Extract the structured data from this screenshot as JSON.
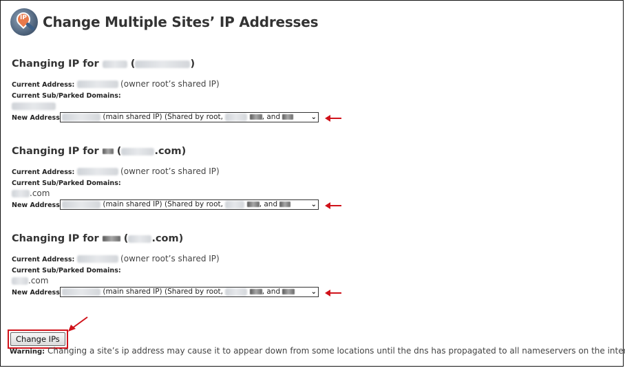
{
  "page": {
    "title": "Change Multiple Sites’ IP Addresses",
    "icon_text": "IP"
  },
  "sections": [
    {
      "heading_prefix": "Changing IP for",
      "heading_domain_suffix": "",
      "current_address_label": "Current Address:",
      "current_address_note": "(owner root’s shared IP)",
      "sub_parked_label": "Current Sub/Parked Domains:",
      "sub_parked_suffix": "",
      "new_address_label": "New Address:",
      "select_text_1": "(main shared IP) (Shared by root,",
      "select_text_2": ", and"
    },
    {
      "heading_prefix": "Changing IP for",
      "heading_domain_suffix": ".com)",
      "current_address_label": "Current Address:",
      "current_address_note": "(owner root’s shared IP)",
      "sub_parked_label": "Current Sub/Parked Domains:",
      "sub_parked_suffix": ".com",
      "new_address_label": "New Address:",
      "select_text_1": "(main shared IP) (Shared by root,",
      "select_text_2": ", and"
    },
    {
      "heading_prefix": "Changing IP for",
      "heading_domain_suffix": ".com)",
      "current_address_label": "Current Address:",
      "current_address_note": "(owner root’s shared IP)",
      "sub_parked_label": "Current Sub/Parked Domains:",
      "sub_parked_suffix": ".com",
      "new_address_label": "New Address:",
      "select_text_1": "(main shared IP) (Shared by root,",
      "select_text_2": ", and"
    }
  ],
  "footer": {
    "button_label": "Change IPs",
    "warning_label": "Warning:",
    "warning_text": "Changing a site’s ip address may cause it to appear down from some locations until the dns has propagated to all nameservers on the internet."
  },
  "colors": {
    "annotation_red": "#d0121a"
  }
}
